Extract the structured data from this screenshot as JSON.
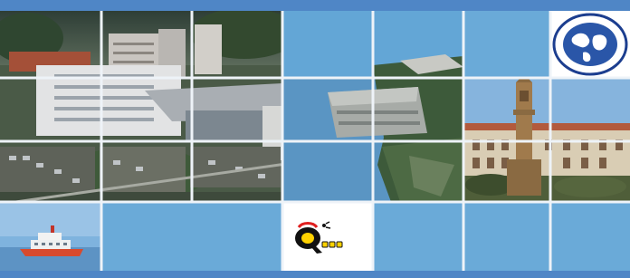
{
  "banner": {
    "colors": {
      "frame_blue": "#4f86c6",
      "tile_blue": "#6aaad8",
      "tile_white": "#ffffff"
    },
    "photos": [
      {
        "name": "campus-aerial-photo"
      },
      {
        "name": "coastal-fortress-photo"
      },
      {
        "name": "palace-tower-photo"
      },
      {
        "name": "ship-photo"
      }
    ],
    "logos": [
      {
        "name": "globe-emblem-logo"
      },
      {
        "name": "q-sed-logo"
      }
    ]
  }
}
